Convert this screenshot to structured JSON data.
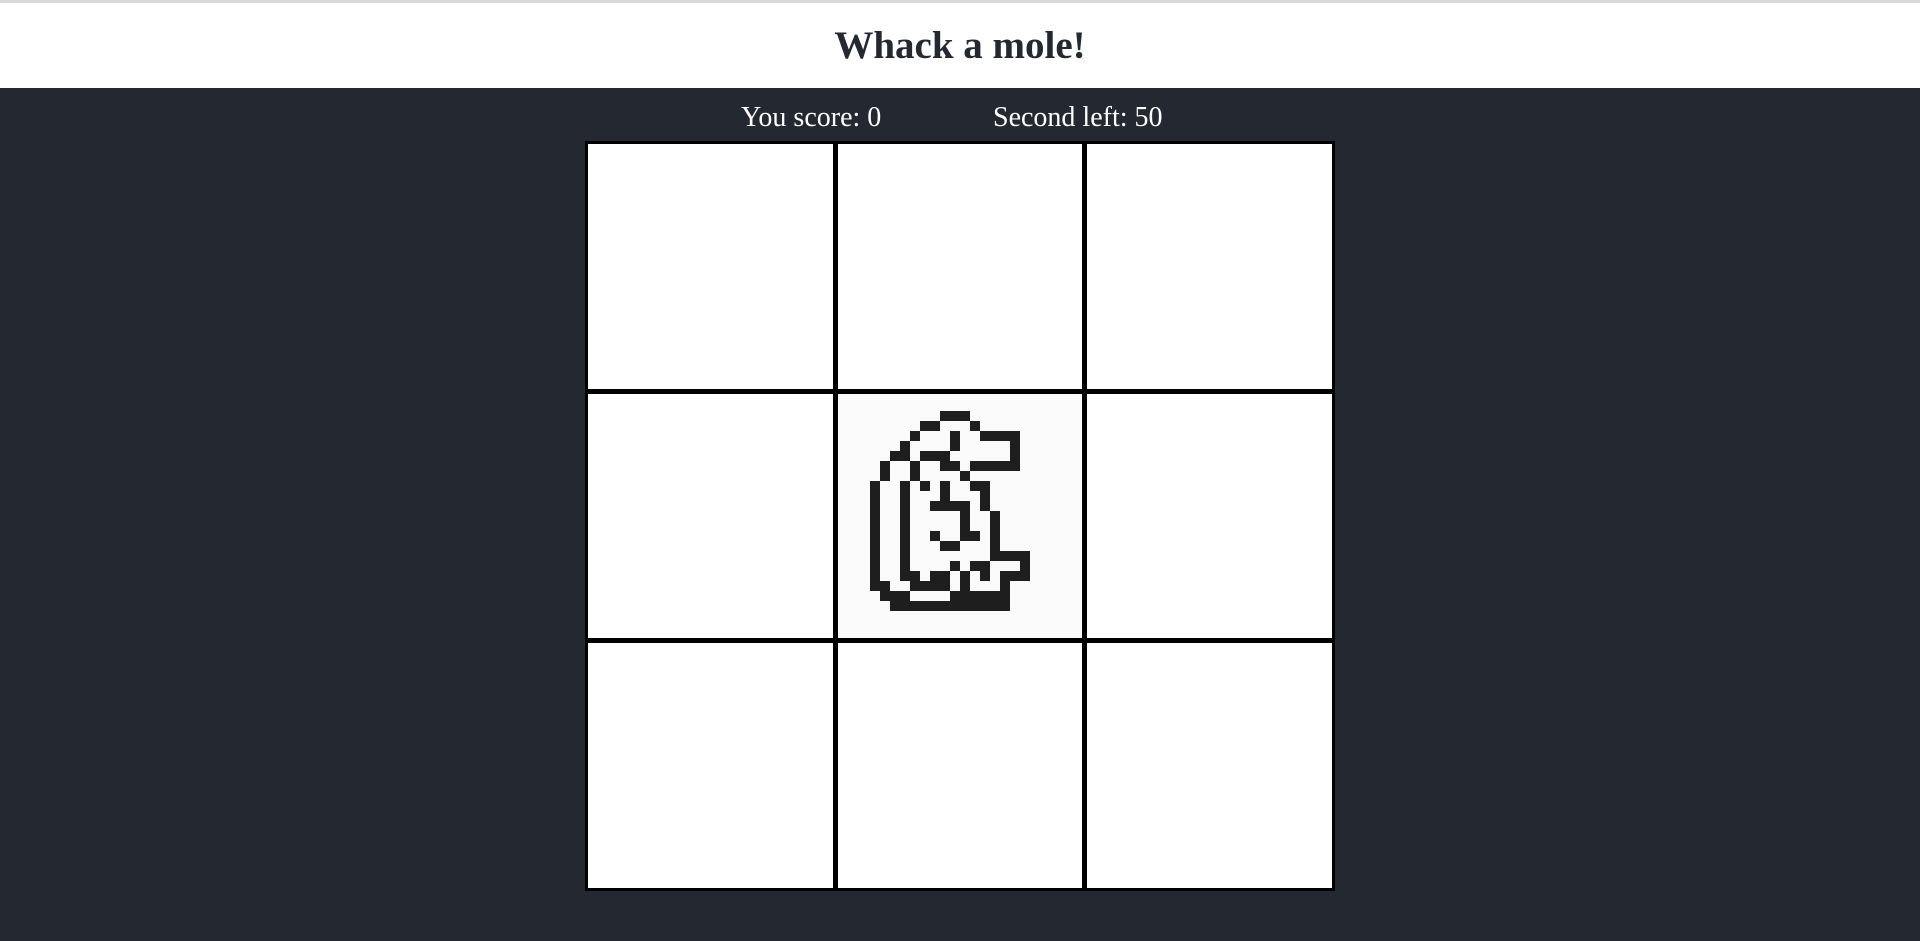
{
  "game": {
    "title": "Whack a mole!",
    "score_label": "You score:",
    "score_value": "0",
    "timer_label": "Second left:",
    "timer_value": "50"
  },
  "board": {
    "rows": 3,
    "cols": 3,
    "active_hole": 4,
    "holes": [
      {
        "index": 0,
        "mole": false
      },
      {
        "index": 1,
        "mole": false
      },
      {
        "index": 2,
        "mole": false
      },
      {
        "index": 3,
        "mole": false
      },
      {
        "index": 4,
        "mole": true,
        "icon": "mole-icon"
      },
      {
        "index": 5,
        "mole": false
      },
      {
        "index": 6,
        "mole": false
      },
      {
        "index": 7,
        "mole": false
      },
      {
        "index": 8,
        "mole": false
      }
    ]
  },
  "colors": {
    "background": "#242830",
    "header_bg": "#ffffff",
    "title": "#242830",
    "text": "#ffffff",
    "grid_line": "#000000",
    "cell": "#ffffff",
    "sprite": "#1e1e1e"
  }
}
